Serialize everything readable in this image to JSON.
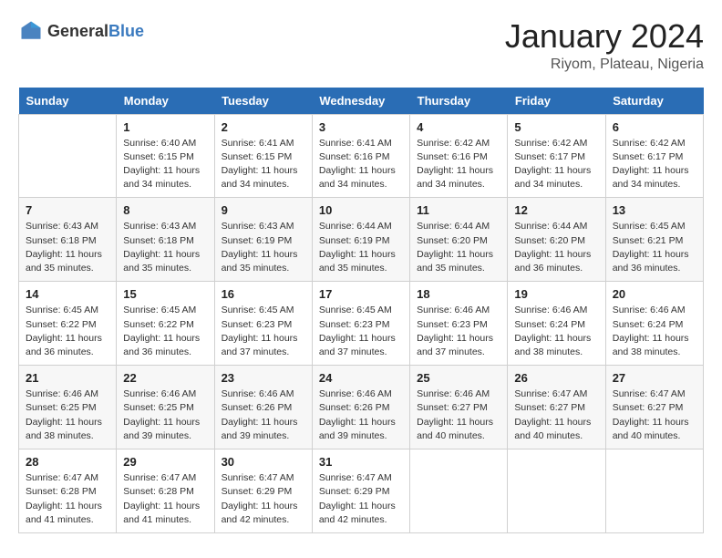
{
  "header": {
    "logo_general": "General",
    "logo_blue": "Blue",
    "title": "January 2024",
    "subtitle": "Riyom, Plateau, Nigeria"
  },
  "weekdays": [
    "Sunday",
    "Monday",
    "Tuesday",
    "Wednesday",
    "Thursday",
    "Friday",
    "Saturday"
  ],
  "weeks": [
    [
      {
        "day": "",
        "sunrise": "",
        "sunset": "",
        "daylight": ""
      },
      {
        "day": "1",
        "sunrise": "Sunrise: 6:40 AM",
        "sunset": "Sunset: 6:15 PM",
        "daylight": "Daylight: 11 hours and 34 minutes."
      },
      {
        "day": "2",
        "sunrise": "Sunrise: 6:41 AM",
        "sunset": "Sunset: 6:15 PM",
        "daylight": "Daylight: 11 hours and 34 minutes."
      },
      {
        "day": "3",
        "sunrise": "Sunrise: 6:41 AM",
        "sunset": "Sunset: 6:16 PM",
        "daylight": "Daylight: 11 hours and 34 minutes."
      },
      {
        "day": "4",
        "sunrise": "Sunrise: 6:42 AM",
        "sunset": "Sunset: 6:16 PM",
        "daylight": "Daylight: 11 hours and 34 minutes."
      },
      {
        "day": "5",
        "sunrise": "Sunrise: 6:42 AM",
        "sunset": "Sunset: 6:17 PM",
        "daylight": "Daylight: 11 hours and 34 minutes."
      },
      {
        "day": "6",
        "sunrise": "Sunrise: 6:42 AM",
        "sunset": "Sunset: 6:17 PM",
        "daylight": "Daylight: 11 hours and 34 minutes."
      }
    ],
    [
      {
        "day": "7",
        "sunrise": "Sunrise: 6:43 AM",
        "sunset": "Sunset: 6:18 PM",
        "daylight": "Daylight: 11 hours and 35 minutes."
      },
      {
        "day": "8",
        "sunrise": "Sunrise: 6:43 AM",
        "sunset": "Sunset: 6:18 PM",
        "daylight": "Daylight: 11 hours and 35 minutes."
      },
      {
        "day": "9",
        "sunrise": "Sunrise: 6:43 AM",
        "sunset": "Sunset: 6:19 PM",
        "daylight": "Daylight: 11 hours and 35 minutes."
      },
      {
        "day": "10",
        "sunrise": "Sunrise: 6:44 AM",
        "sunset": "Sunset: 6:19 PM",
        "daylight": "Daylight: 11 hours and 35 minutes."
      },
      {
        "day": "11",
        "sunrise": "Sunrise: 6:44 AM",
        "sunset": "Sunset: 6:20 PM",
        "daylight": "Daylight: 11 hours and 35 minutes."
      },
      {
        "day": "12",
        "sunrise": "Sunrise: 6:44 AM",
        "sunset": "Sunset: 6:20 PM",
        "daylight": "Daylight: 11 hours and 36 minutes."
      },
      {
        "day": "13",
        "sunrise": "Sunrise: 6:45 AM",
        "sunset": "Sunset: 6:21 PM",
        "daylight": "Daylight: 11 hours and 36 minutes."
      }
    ],
    [
      {
        "day": "14",
        "sunrise": "Sunrise: 6:45 AM",
        "sunset": "Sunset: 6:22 PM",
        "daylight": "Daylight: 11 hours and 36 minutes."
      },
      {
        "day": "15",
        "sunrise": "Sunrise: 6:45 AM",
        "sunset": "Sunset: 6:22 PM",
        "daylight": "Daylight: 11 hours and 36 minutes."
      },
      {
        "day": "16",
        "sunrise": "Sunrise: 6:45 AM",
        "sunset": "Sunset: 6:23 PM",
        "daylight": "Daylight: 11 hours and 37 minutes."
      },
      {
        "day": "17",
        "sunrise": "Sunrise: 6:45 AM",
        "sunset": "Sunset: 6:23 PM",
        "daylight": "Daylight: 11 hours and 37 minutes."
      },
      {
        "day": "18",
        "sunrise": "Sunrise: 6:46 AM",
        "sunset": "Sunset: 6:23 PM",
        "daylight": "Daylight: 11 hours and 37 minutes."
      },
      {
        "day": "19",
        "sunrise": "Sunrise: 6:46 AM",
        "sunset": "Sunset: 6:24 PM",
        "daylight": "Daylight: 11 hours and 38 minutes."
      },
      {
        "day": "20",
        "sunrise": "Sunrise: 6:46 AM",
        "sunset": "Sunset: 6:24 PM",
        "daylight": "Daylight: 11 hours and 38 minutes."
      }
    ],
    [
      {
        "day": "21",
        "sunrise": "Sunrise: 6:46 AM",
        "sunset": "Sunset: 6:25 PM",
        "daylight": "Daylight: 11 hours and 38 minutes."
      },
      {
        "day": "22",
        "sunrise": "Sunrise: 6:46 AM",
        "sunset": "Sunset: 6:25 PM",
        "daylight": "Daylight: 11 hours and 39 minutes."
      },
      {
        "day": "23",
        "sunrise": "Sunrise: 6:46 AM",
        "sunset": "Sunset: 6:26 PM",
        "daylight": "Daylight: 11 hours and 39 minutes."
      },
      {
        "day": "24",
        "sunrise": "Sunrise: 6:46 AM",
        "sunset": "Sunset: 6:26 PM",
        "daylight": "Daylight: 11 hours and 39 minutes."
      },
      {
        "day": "25",
        "sunrise": "Sunrise: 6:46 AM",
        "sunset": "Sunset: 6:27 PM",
        "daylight": "Daylight: 11 hours and 40 minutes."
      },
      {
        "day": "26",
        "sunrise": "Sunrise: 6:47 AM",
        "sunset": "Sunset: 6:27 PM",
        "daylight": "Daylight: 11 hours and 40 minutes."
      },
      {
        "day": "27",
        "sunrise": "Sunrise: 6:47 AM",
        "sunset": "Sunset: 6:27 PM",
        "daylight": "Daylight: 11 hours and 40 minutes."
      }
    ],
    [
      {
        "day": "28",
        "sunrise": "Sunrise: 6:47 AM",
        "sunset": "Sunset: 6:28 PM",
        "daylight": "Daylight: 11 hours and 41 minutes."
      },
      {
        "day": "29",
        "sunrise": "Sunrise: 6:47 AM",
        "sunset": "Sunset: 6:28 PM",
        "daylight": "Daylight: 11 hours and 41 minutes."
      },
      {
        "day": "30",
        "sunrise": "Sunrise: 6:47 AM",
        "sunset": "Sunset: 6:29 PM",
        "daylight": "Daylight: 11 hours and 42 minutes."
      },
      {
        "day": "31",
        "sunrise": "Sunrise: 6:47 AM",
        "sunset": "Sunset: 6:29 PM",
        "daylight": "Daylight: 11 hours and 42 minutes."
      },
      {
        "day": "",
        "sunrise": "",
        "sunset": "",
        "daylight": ""
      },
      {
        "day": "",
        "sunrise": "",
        "sunset": "",
        "daylight": ""
      },
      {
        "day": "",
        "sunrise": "",
        "sunset": "",
        "daylight": ""
      }
    ]
  ]
}
